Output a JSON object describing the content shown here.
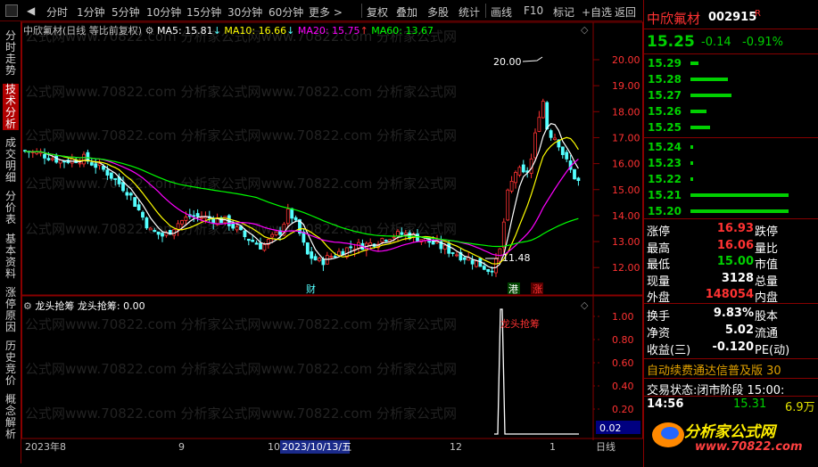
{
  "toolbar": {
    "periods": [
      "分时",
      "1分钟",
      "5分钟",
      "10分钟",
      "15分钟",
      "30分钟",
      "60分钟",
      "更多"
    ],
    "actions": [
      "复权",
      "叠加",
      "多股",
      "统计",
      "画线",
      "F10",
      "标记",
      "+自选",
      "返回"
    ]
  },
  "sidetabs": [
    "分时走势",
    "技术分析",
    "成交明细",
    "分价表",
    "基本资料",
    "涨停原因",
    "历史竞价",
    "概念解析"
  ],
  "main": {
    "title": "中欣氟材(日线 等比前复权)",
    "ma5_label": "MA5: 15.81",
    "ma10_label": "MA10: 16.66",
    "ma20_label": "MA20: 15.75",
    "ma60_label": "MA60: 13.67",
    "ma5_arrow": "↓",
    "ma10_arrow": "↓",
    "ma20_arrow": "↑",
    "high_mark": "20.00",
    "low_mark": "11.48",
    "badge_cai": "财",
    "badge_gang": "港",
    "badge_zhang": "涨",
    "watermark": "公式网www.70822.com 分析家公式网www.70822.com 分析家公式网"
  },
  "price_axis": [
    "20.00",
    "19.00",
    "18.00",
    "17.00",
    "16.00",
    "15.00",
    "14.00",
    "13.00",
    "12.00"
  ],
  "sub": {
    "title": "龙头抢筹",
    "value_label": "龙头抢筹: 0.00",
    "signal_label": "龙头抢筹",
    "axis": [
      "1.00",
      "0.80",
      "0.60",
      "0.40",
      "0.20"
    ],
    "current": "0.02"
  },
  "timeline": {
    "labels": [
      "2023年8",
      "9",
      "10",
      "2023/10/13/五",
      "12",
      "1"
    ],
    "period": "日线"
  },
  "colors": {
    "up": "#ff3232",
    "down": "#54ffff",
    "ma5": "#ffffff",
    "ma10": "#ffff00",
    "ma20": "#ff00ff",
    "ma60": "#00ff00"
  },
  "quote": {
    "name": "中欣氟材",
    "code": "002915",
    "flag": "R",
    "price": "15.25",
    "change": "-0.14",
    "pct": "-0.91%",
    "book": [
      {
        "price": "15.29",
        "bar": 0.08
      },
      {
        "price": "15.28",
        "bar": 0.38
      },
      {
        "price": "15.27",
        "bar": 0.42
      },
      {
        "price": "15.26",
        "bar": 0.16
      },
      {
        "price": "15.25",
        "bar": 0.2
      },
      {
        "price": "15.24",
        "bar": 0.02
      },
      {
        "price": "15.23",
        "bar": 0.02
      },
      {
        "price": "15.22",
        "bar": 0.02
      },
      {
        "price": "15.21",
        "bar": 1.0
      },
      {
        "price": "15.20",
        "bar": 1.0
      }
    ],
    "stats": [
      {
        "k": "涨停",
        "v": "16.93",
        "k2": "跌停"
      },
      {
        "k": "最高",
        "v": "16.06",
        "k2": "量比"
      },
      {
        "k": "最低",
        "v": "15.00",
        "k2": "市值"
      },
      {
        "k": "现量",
        "v": "3128",
        "k2": "总量"
      },
      {
        "k": "外盘",
        "v": "148054",
        "k2": "内盘"
      }
    ],
    "stats2": [
      {
        "k": "换手",
        "v": "9.83%",
        "k2": "股本"
      },
      {
        "k": "净资",
        "v": "5.02",
        "k2": "流通"
      },
      {
        "k": "收益(三)",
        "v": "-0.120",
        "k2": "PE(动)"
      }
    ],
    "promo": "自动续费通达信普及版",
    "promo_num": "30",
    "trade_state_label": "交易状态:",
    "trade_state": "闭市阶段",
    "trade_time": "15:00:",
    "tick_time": "14:56",
    "tick_price": "15.31",
    "tick_vol": "6.9万",
    "logo_text": "分析家公式网",
    "logo_url": "www.70822.com"
  }
}
